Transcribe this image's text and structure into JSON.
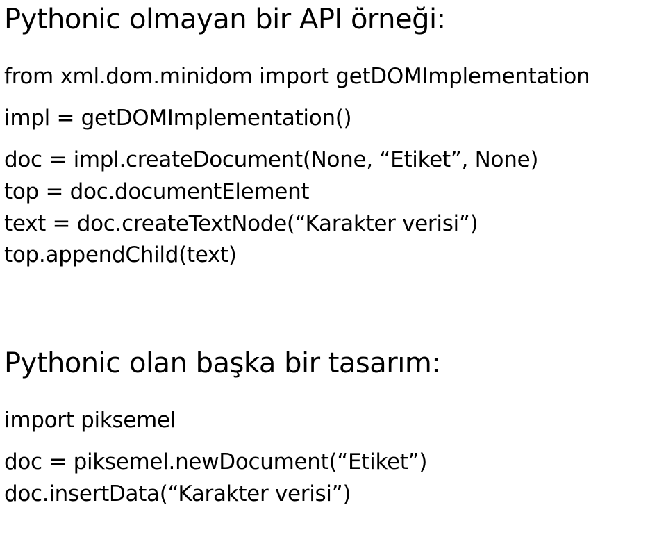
{
  "section1": {
    "heading": "Pythonic olmayan bir API örneği:",
    "code_line1": "from xml.dom.minidom import getDOMImplementation",
    "code_line2": "impl = getDOMImplementation()",
    "code_line3": "doc = impl.createDocument(None, “Etiket”, None)",
    "code_line4": "top = doc.documentElement",
    "code_line5": "text = doc.createTextNode(“Karakter verisi”)",
    "code_line6": "top.appendChild(text)"
  },
  "section2": {
    "heading": "Pythonic olan başka bir tasarım:",
    "code_line1": "import piksemel",
    "code_line2": "doc = piksemel.newDocument(“Etiket”)",
    "code_line3": "doc.insertData(“Karakter verisi”)"
  }
}
